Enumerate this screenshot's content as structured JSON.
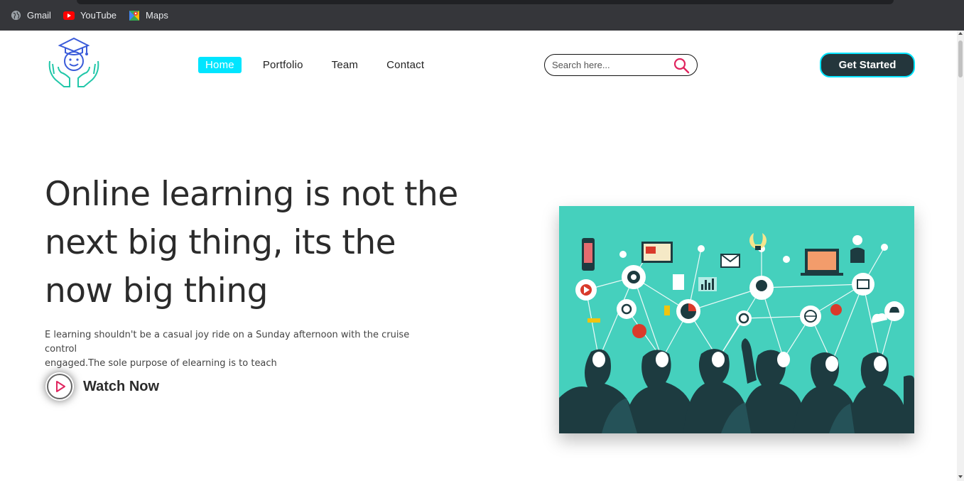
{
  "bookmarks": [
    {
      "label": "Gmail",
      "icon": "globe-icon"
    },
    {
      "label": "YouTube",
      "icon": "youtube-icon"
    },
    {
      "label": "Maps",
      "icon": "maps-icon"
    }
  ],
  "nav": {
    "items": [
      {
        "label": "Home",
        "active": true
      },
      {
        "label": "Portfolio",
        "active": false
      },
      {
        "label": "Team",
        "active": false
      },
      {
        "label": "Contact",
        "active": false
      }
    ]
  },
  "search": {
    "placeholder": "Search here...",
    "value": ""
  },
  "cta": {
    "label": "Get Started"
  },
  "hero": {
    "title_lines": [
      "Online learning is not the",
      "next big thing, its the",
      "now big thing"
    ],
    "subtitle_lines": [
      "E learning shouldn't be a casual joy ride on a Sunday afternoon with the cruise control",
      "engaged.The sole purpose of elearning is to teach"
    ],
    "watch_label": "Watch Now"
  },
  "colors": {
    "accent": "#00e5ff",
    "dark": "#24363c",
    "hero_image_bg": "#45d0bd",
    "search_icon": "#e0245e"
  }
}
